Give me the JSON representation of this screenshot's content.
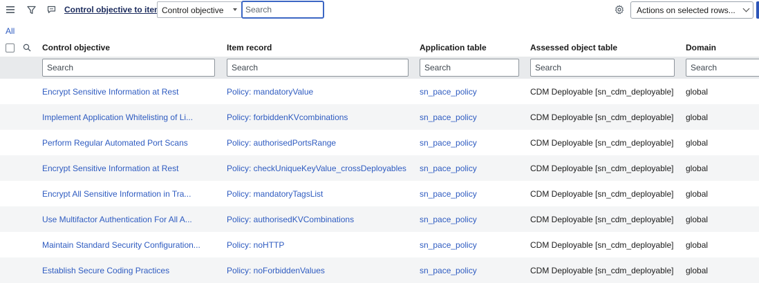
{
  "toolbar": {
    "title": "Control objective to items",
    "search_field_select": "Control objective",
    "search_placeholder": "Search",
    "actions_label": "Actions on selected rows..."
  },
  "breadcrumb": {
    "label": "All"
  },
  "table": {
    "columns": [
      "Control objective",
      "Item record",
      "Application table",
      "Assessed object table",
      "Domain"
    ],
    "filter_placeholder": "Search",
    "rows": [
      [
        "Encrypt Sensitive Information at Rest",
        "Policy: mandatoryValue",
        "sn_pace_policy",
        "CDM Deployable [sn_cdm_deployable]",
        "global"
      ],
      [
        "Implement Application Whitelisting of Li...",
        "Policy: forbiddenKVcombinations",
        "sn_pace_policy",
        "CDM Deployable [sn_cdm_deployable]",
        "global"
      ],
      [
        "Perform Regular Automated Port Scans",
        "Policy: authorisedPortsRange",
        "sn_pace_policy",
        "CDM Deployable [sn_cdm_deployable]",
        "global"
      ],
      [
        "Encrypt Sensitive Information at Rest",
        "Policy: checkUniqueKeyValue_crossDeployables",
        "sn_pace_policy",
        "CDM Deployable [sn_cdm_deployable]",
        "global"
      ],
      [
        "Encrypt All Sensitive Information in Tra...",
        "Policy: mandatoryTagsList",
        "sn_pace_policy",
        "CDM Deployable [sn_cdm_deployable]",
        "global"
      ],
      [
        "Use Multifactor Authentication For All A...",
        "Policy: authorisedKVCombinations",
        "sn_pace_policy",
        "CDM Deployable [sn_cdm_deployable]",
        "global"
      ],
      [
        "Maintain Standard Security Configuration...",
        "Policy: noHTTP",
        "sn_pace_policy",
        "CDM Deployable [sn_cdm_deployable]",
        "global"
      ],
      [
        "Establish Secure Coding Practices",
        "Policy: noForbiddenValues",
        "sn_pace_policy",
        "CDM Deployable [sn_cdm_deployable]",
        "global"
      ]
    ]
  },
  "icons": {
    "menu": "hamburger-menu-icon",
    "filter": "funnel-filter-icon",
    "chat": "chat-bubble-icon",
    "gear": "gear-icon",
    "column_search": "magnifier-search-icon"
  },
  "colors": {
    "link": "#2e5bc0",
    "focus_border": "#3b66c4",
    "filter_row_bg": "#e8eaec",
    "striped_row_bg": "#f4f5f6"
  }
}
